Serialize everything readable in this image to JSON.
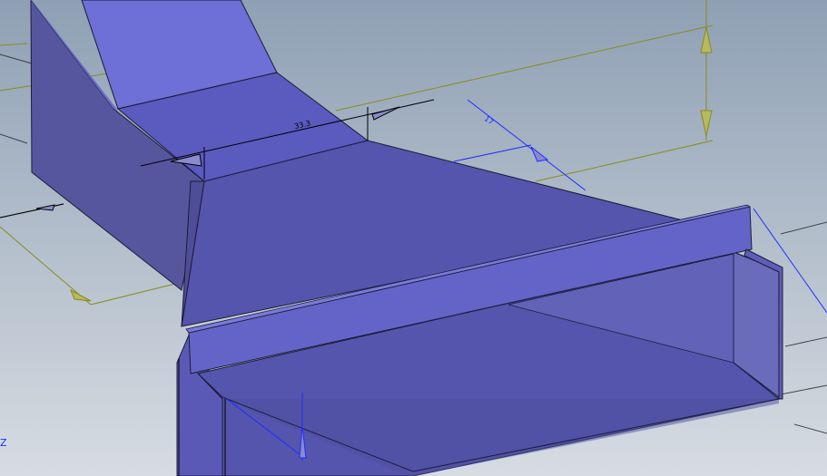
{
  "viewport": {
    "background_top": "#8fa0b4",
    "background_bottom": "#d6dce2",
    "part_face_light": "#6f6fd8",
    "part_face_mid": "#5a5abf",
    "part_face_dark": "#4f4fa6",
    "part_face_inner": "#6767b8",
    "edge_color": "#1b1b3a",
    "dimension_color_olive": "#8a8a1c",
    "dimension_color_blue": "#1f2fff",
    "dimension_color_black": "#000000"
  },
  "dimensions": {
    "top_length_label": "33.3",
    "blue_length_label": "17"
  },
  "triad": {
    "z_label": "Z"
  }
}
